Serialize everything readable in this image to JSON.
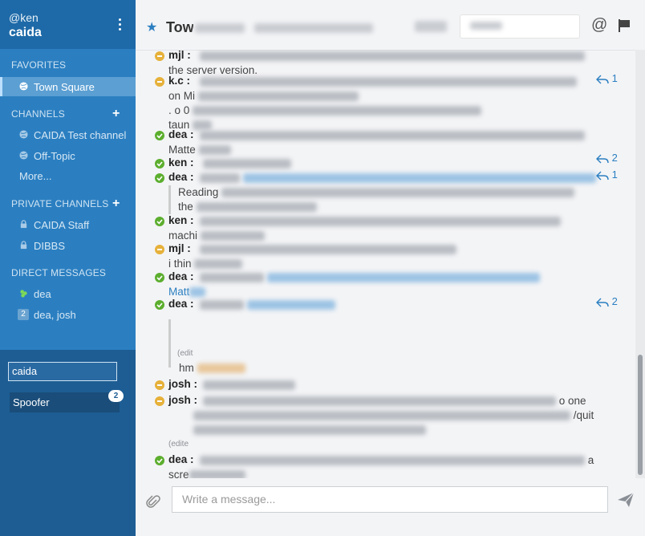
{
  "sidebar": {
    "handle": "@ken",
    "team_name": "caida",
    "favorites_title": "FAVORITES",
    "favorites": [
      {
        "label": "Town Square"
      }
    ],
    "channels_title": "CHANNELS",
    "channels": [
      {
        "label": "CAIDA Test channel"
      },
      {
        "label": "Off-Topic"
      }
    ],
    "more_label": "More...",
    "private_title": "PRIVATE CHANNELS",
    "private_channels": [
      {
        "label": "CAIDA Staff"
      },
      {
        "label": "DIBBS"
      }
    ],
    "dm_title": "DIRECT MESSAGES",
    "direct_messages": [
      {
        "label": "dea"
      },
      {
        "label": "dea, josh",
        "count": "2"
      }
    ],
    "team_search_value": "caida",
    "other_team": "Spoofer",
    "other_team_badge": "2"
  },
  "header": {
    "channel_name": "Town Square",
    "search_placeholder": "Search"
  },
  "posts": [
    {
      "user": "mjl :",
      "status": "away",
      "line1": "",
      "line2": "the server version."
    },
    {
      "user": "k.c :",
      "status": "away",
      "line2": "on Mi",
      "line3": ". o 0",
      "line4": "taun",
      "reply_count": "1"
    },
    {
      "user": "dea :",
      "status": "online",
      "line2": "Matte"
    },
    {
      "user": "ken :",
      "status": "online",
      "reply_count": "2"
    },
    {
      "user": "dea :",
      "status": "online",
      "quote1": "Reading",
      "quote2": "the",
      "reply_count": "1"
    },
    {
      "user": "ken :",
      "status": "online",
      "line2": "machi"
    },
    {
      "user": "mjl :",
      "status": "away",
      "line2": "i thin"
    },
    {
      "user": "dea :",
      "status": "online",
      "line2": "Matt"
    },
    {
      "user": "dea :",
      "status": "online",
      "reply_count": "2"
    },
    {
      "edited": "(edit",
      "text": "hm"
    },
    {
      "user": "josh :",
      "status": "away"
    },
    {
      "user": "josh :",
      "status": "away",
      "tail1": "o one",
      "tail2": "/quit"
    },
    {
      "edited": "(edite"
    },
    {
      "user": "dea :",
      "status": "online",
      "tail1": "a",
      "line2": "scre"
    }
  ],
  "composer": {
    "placeholder": "Write a message..."
  },
  "colors": {
    "sidebar": "#2b7fc1",
    "sidebar_header": "#1e6aa8",
    "team_panel": "#1d5d94",
    "online": "#5cae2e",
    "away": "#e6b13a",
    "link": "#2b7fc1"
  }
}
